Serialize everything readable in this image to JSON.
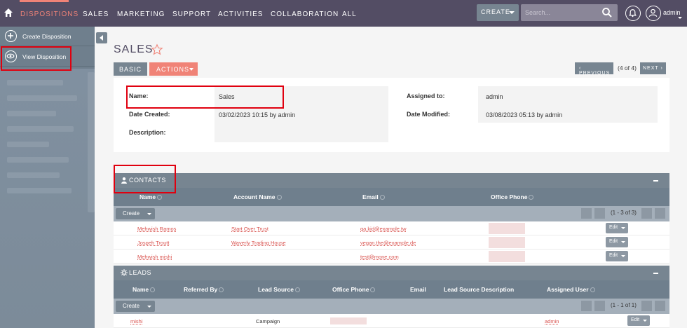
{
  "nav": {
    "items": [
      "DISPOSITIONS",
      "SALES",
      "MARKETING",
      "SUPPORT",
      "ACTIVITIES",
      "COLLABORATION",
      "ALL"
    ],
    "create_label": "CREATE",
    "search_placeholder": "Search...",
    "user_label": "admin"
  },
  "sidebar": {
    "items": [
      "Create Disposition",
      "View Disposition"
    ]
  },
  "record": {
    "title": "SALES",
    "tabs": {
      "basic": "BASIC",
      "actions": "ACTIONS"
    },
    "pager": {
      "previous": "PREVIOUS",
      "count": "(4 of 4)",
      "next": "NEXT"
    },
    "fields": {
      "name_label": "Name:",
      "name_value": "Sales",
      "assigned_label": "Assigned to:",
      "assigned_value": "admin",
      "created_label": "Date Created:",
      "created_value": "03/02/2023 10:15 by admin",
      "modified_label": "Date Modified:",
      "modified_value": "03/08/2023 05:13 by admin",
      "description_label": "Description:"
    }
  },
  "contacts": {
    "title": "CONTACTS",
    "columns": [
      "Name",
      "Account Name",
      "Email",
      "Office Phone"
    ],
    "create_label": "Create",
    "range": "(1 - 3 of 3)",
    "edit_label": "Edit",
    "rows": [
      {
        "name": "Mehwish Ramos",
        "account": "Start Over Trust",
        "email": "qa.kid@example.tw"
      },
      {
        "name": "Jospeh Troutt",
        "account": "Waverly Trading House",
        "email": "vegan.the@example.de"
      },
      {
        "name": "Mehwish mishi",
        "account": "",
        "email": "test@mone.com"
      }
    ]
  },
  "leads": {
    "title": "LEADS",
    "columns": [
      "Name",
      "Referred By",
      "Lead Source",
      "Office Phone",
      "Email",
      "Lead Source Description",
      "Assigned User"
    ],
    "create_label": "Create",
    "range": "(1 - 1 of 1)",
    "edit_label": "Edit",
    "rows": [
      {
        "name": "mishi",
        "lead_source": "Campaign",
        "assigned": "admin"
      }
    ]
  },
  "colors": {
    "nav_bg": "#534d64",
    "accent": "#f08377",
    "panel_header": "#778591",
    "highlight": "#e0000f"
  }
}
